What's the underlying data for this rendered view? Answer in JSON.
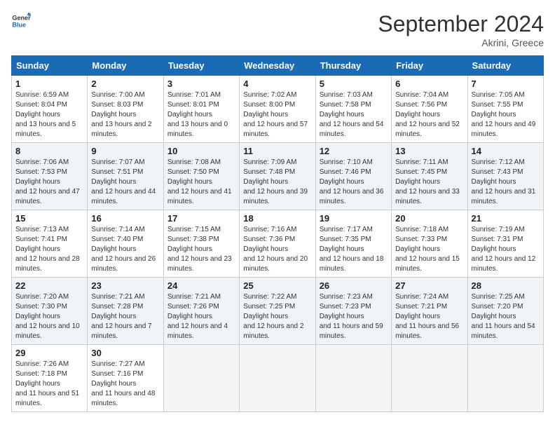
{
  "header": {
    "logo_line1": "General",
    "logo_line2": "Blue",
    "month_title": "September 2024",
    "location": "Akrini, Greece"
  },
  "weekdays": [
    "Sunday",
    "Monday",
    "Tuesday",
    "Wednesday",
    "Thursday",
    "Friday",
    "Saturday"
  ],
  "weeks": [
    [
      {
        "day": "1",
        "sunrise": "6:59 AM",
        "sunset": "8:04 PM",
        "daylight": "13 hours and 5 minutes."
      },
      {
        "day": "2",
        "sunrise": "7:00 AM",
        "sunset": "8:03 PM",
        "daylight": "13 hours and 2 minutes."
      },
      {
        "day": "3",
        "sunrise": "7:01 AM",
        "sunset": "8:01 PM",
        "daylight": "13 hours and 0 minutes."
      },
      {
        "day": "4",
        "sunrise": "7:02 AM",
        "sunset": "8:00 PM",
        "daylight": "12 hours and 57 minutes."
      },
      {
        "day": "5",
        "sunrise": "7:03 AM",
        "sunset": "7:58 PM",
        "daylight": "12 hours and 54 minutes."
      },
      {
        "day": "6",
        "sunrise": "7:04 AM",
        "sunset": "7:56 PM",
        "daylight": "12 hours and 52 minutes."
      },
      {
        "day": "7",
        "sunrise": "7:05 AM",
        "sunset": "7:55 PM",
        "daylight": "12 hours and 49 minutes."
      }
    ],
    [
      {
        "day": "8",
        "sunrise": "7:06 AM",
        "sunset": "7:53 PM",
        "daylight": "12 hours and 47 minutes."
      },
      {
        "day": "9",
        "sunrise": "7:07 AM",
        "sunset": "7:51 PM",
        "daylight": "12 hours and 44 minutes."
      },
      {
        "day": "10",
        "sunrise": "7:08 AM",
        "sunset": "7:50 PM",
        "daylight": "12 hours and 41 minutes."
      },
      {
        "day": "11",
        "sunrise": "7:09 AM",
        "sunset": "7:48 PM",
        "daylight": "12 hours and 39 minutes."
      },
      {
        "day": "12",
        "sunrise": "7:10 AM",
        "sunset": "7:46 PM",
        "daylight": "12 hours and 36 minutes."
      },
      {
        "day": "13",
        "sunrise": "7:11 AM",
        "sunset": "7:45 PM",
        "daylight": "12 hours and 33 minutes."
      },
      {
        "day": "14",
        "sunrise": "7:12 AM",
        "sunset": "7:43 PM",
        "daylight": "12 hours and 31 minutes."
      }
    ],
    [
      {
        "day": "15",
        "sunrise": "7:13 AM",
        "sunset": "7:41 PM",
        "daylight": "12 hours and 28 minutes."
      },
      {
        "day": "16",
        "sunrise": "7:14 AM",
        "sunset": "7:40 PM",
        "daylight": "12 hours and 26 minutes."
      },
      {
        "day": "17",
        "sunrise": "7:15 AM",
        "sunset": "7:38 PM",
        "daylight": "12 hours and 23 minutes."
      },
      {
        "day": "18",
        "sunrise": "7:16 AM",
        "sunset": "7:36 PM",
        "daylight": "12 hours and 20 minutes."
      },
      {
        "day": "19",
        "sunrise": "7:17 AM",
        "sunset": "7:35 PM",
        "daylight": "12 hours and 18 minutes."
      },
      {
        "day": "20",
        "sunrise": "7:18 AM",
        "sunset": "7:33 PM",
        "daylight": "12 hours and 15 minutes."
      },
      {
        "day": "21",
        "sunrise": "7:19 AM",
        "sunset": "7:31 PM",
        "daylight": "12 hours and 12 minutes."
      }
    ],
    [
      {
        "day": "22",
        "sunrise": "7:20 AM",
        "sunset": "7:30 PM",
        "daylight": "12 hours and 10 minutes."
      },
      {
        "day": "23",
        "sunrise": "7:21 AM",
        "sunset": "7:28 PM",
        "daylight": "12 hours and 7 minutes."
      },
      {
        "day": "24",
        "sunrise": "7:21 AM",
        "sunset": "7:26 PM",
        "daylight": "12 hours and 4 minutes."
      },
      {
        "day": "25",
        "sunrise": "7:22 AM",
        "sunset": "7:25 PM",
        "daylight": "12 hours and 2 minutes."
      },
      {
        "day": "26",
        "sunrise": "7:23 AM",
        "sunset": "7:23 PM",
        "daylight": "11 hours and 59 minutes."
      },
      {
        "day": "27",
        "sunrise": "7:24 AM",
        "sunset": "7:21 PM",
        "daylight": "11 hours and 56 minutes."
      },
      {
        "day": "28",
        "sunrise": "7:25 AM",
        "sunset": "7:20 PM",
        "daylight": "11 hours and 54 minutes."
      }
    ],
    [
      {
        "day": "29",
        "sunrise": "7:26 AM",
        "sunset": "7:18 PM",
        "daylight": "11 hours and 51 minutes."
      },
      {
        "day": "30",
        "sunrise": "7:27 AM",
        "sunset": "7:16 PM",
        "daylight": "11 hours and 48 minutes."
      },
      null,
      null,
      null,
      null,
      null
    ]
  ]
}
